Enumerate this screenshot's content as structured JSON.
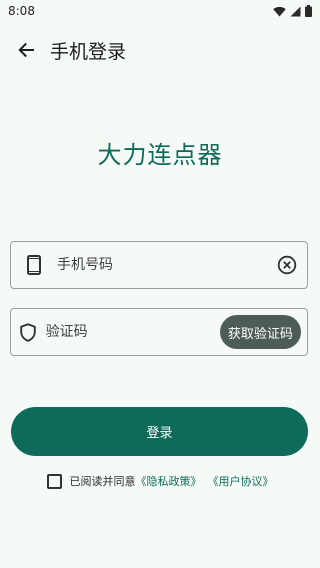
{
  "status_bar": {
    "time": "8:08",
    "icons": [
      "wifi-icon",
      "cellular-signal-icon",
      "battery-icon"
    ]
  },
  "app_bar": {
    "back_icon": "arrow-left-icon",
    "title": "手机登录"
  },
  "brand": {
    "title": "大力连点器"
  },
  "phone": {
    "icon": "smartphone-icon",
    "value": "",
    "placeholder": "手机号码",
    "clear_icon": "clear-circle-icon"
  },
  "code": {
    "icon": "shield-icon",
    "value": "",
    "placeholder": "验证码",
    "button_label": "获取验证码"
  },
  "login": {
    "label": "登录"
  },
  "agreement": {
    "checked": false,
    "text": "已阅读并同意",
    "privacy_link": "《隐私政策》",
    "user_link": "《用户协议》"
  },
  "colors": {
    "primary": "#0e6b5a",
    "secondary_button": "#4e5c58",
    "background": "#f6faf6",
    "outline": "#9aa19d"
  }
}
